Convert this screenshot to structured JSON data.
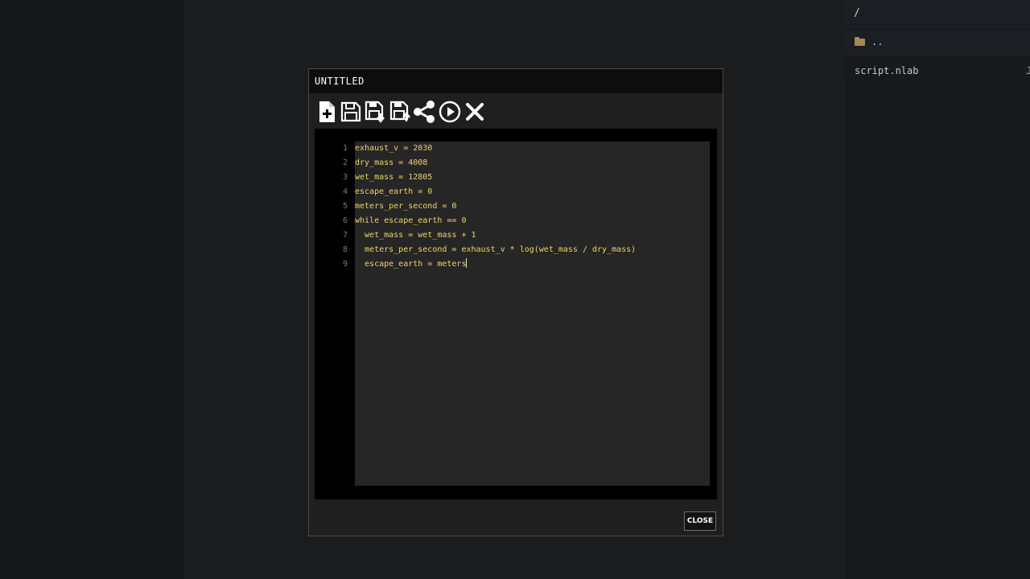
{
  "file_browser": {
    "path": "/",
    "entries": [
      {
        "label": "..",
        "icon": "folder-icon"
      },
      {
        "label": "script.nlab",
        "trailing": "J"
      }
    ]
  },
  "dialog": {
    "title": "UNTITLED",
    "toolbar": [
      {
        "name": "new-file-button",
        "icon": "new-file-icon"
      },
      {
        "name": "save-button",
        "icon": "save-icon"
      },
      {
        "name": "save-download-button",
        "icon": "save-download-icon"
      },
      {
        "name": "save-upload-button",
        "icon": "save-upload-icon"
      },
      {
        "name": "share-button",
        "icon": "share-icon"
      },
      {
        "name": "run-button",
        "icon": "play-icon"
      },
      {
        "name": "clear-button",
        "icon": "close-icon"
      }
    ],
    "close_label": "CLOSE"
  },
  "editor": {
    "lines": [
      {
        "num": "1",
        "code": "exhaust_v = 2030"
      },
      {
        "num": "2",
        "code": "dry_mass = 4008"
      },
      {
        "num": "3",
        "code": "wet_mass = 12805"
      },
      {
        "num": "4",
        "code": "escape_earth = 0"
      },
      {
        "num": "5",
        "code": "meters_per_second = 0"
      },
      {
        "num": "6",
        "code": "while escape_earth == 0"
      },
      {
        "num": "7",
        "code": "  wet_mass = wet_mass + 1"
      },
      {
        "num": "8",
        "code": "  meters_per_second = exhaust_v * log(wet_mass / dry_mass)"
      },
      {
        "num": "9",
        "code": "  escape_earth = meters"
      }
    ]
  },
  "colors": {
    "code_text": "#f1d36a",
    "line_number": "#7a7a7a",
    "folder": "#a58a55"
  }
}
